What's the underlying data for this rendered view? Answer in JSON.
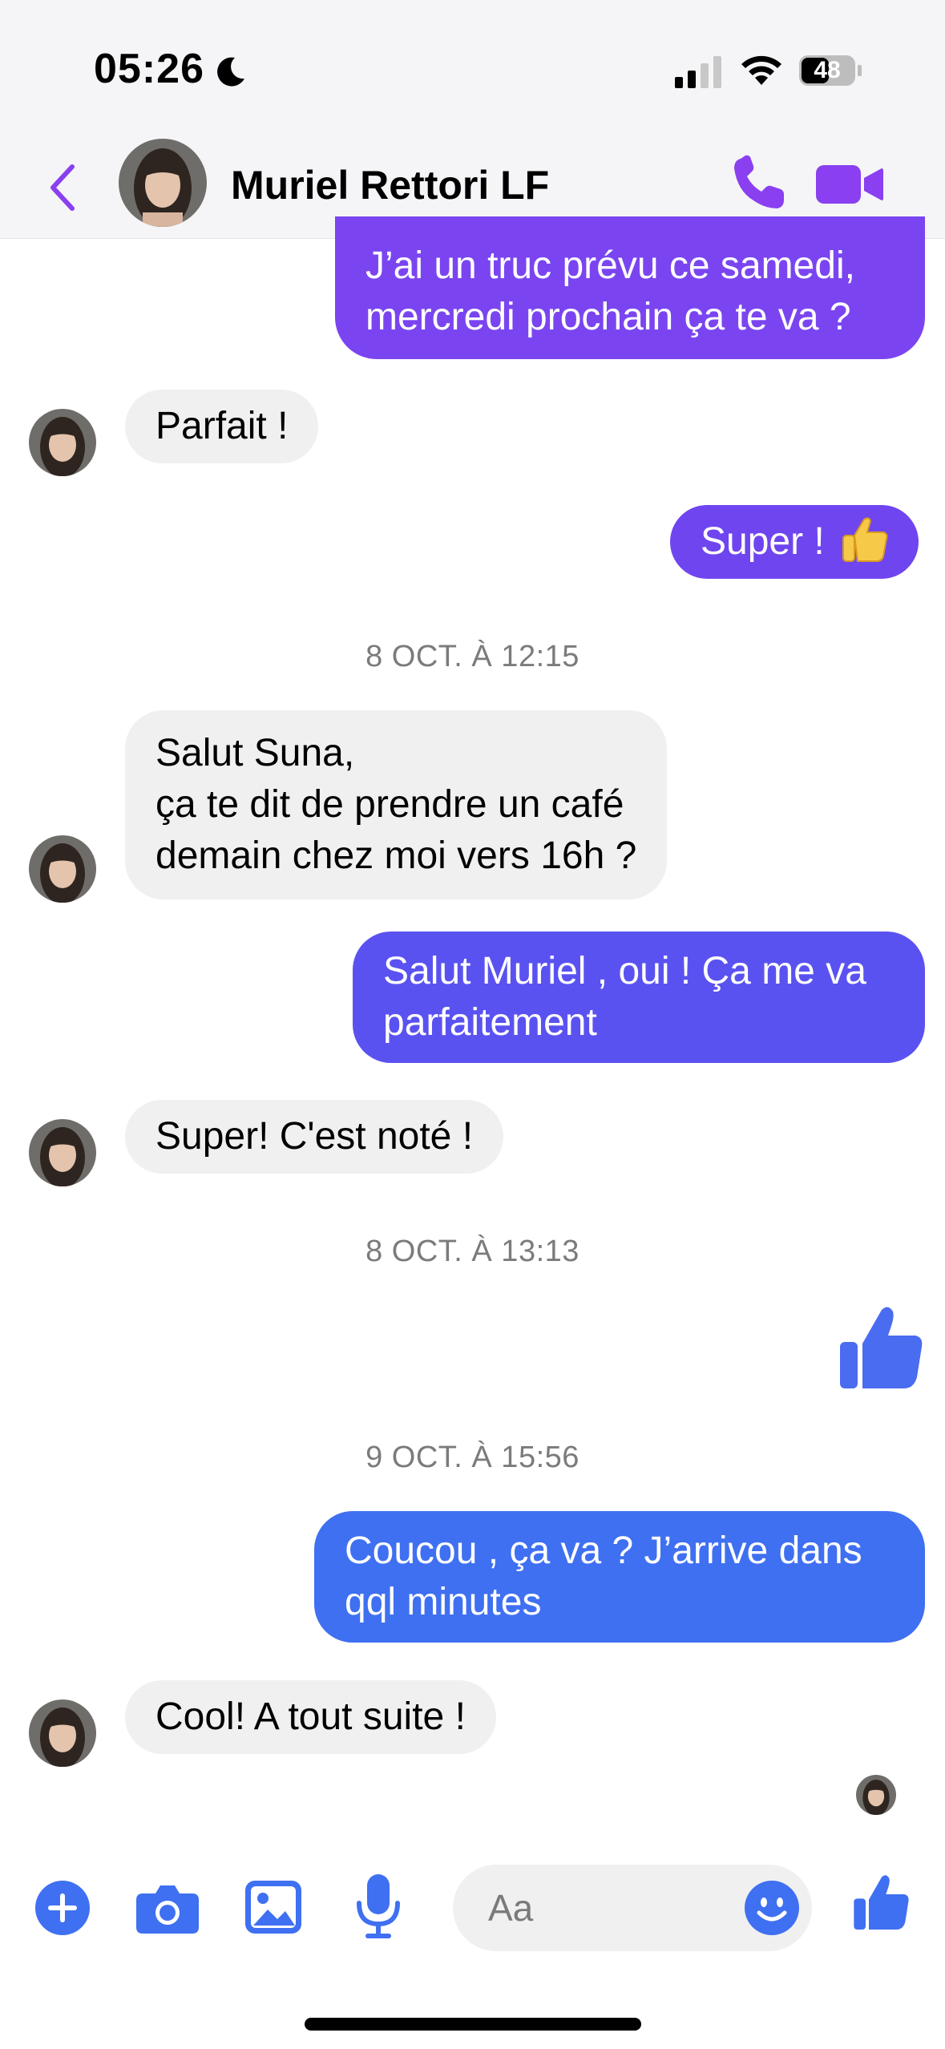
{
  "status_bar": {
    "time": "05:26",
    "battery": "48",
    "moon_icon": "moon-icon",
    "signal_icon": "cellular-signal-icon",
    "wifi_icon": "wifi-icon"
  },
  "header": {
    "name": "Muriel Rettori LF",
    "back_icon": "chevron-left-icon",
    "call_icon": "phone-icon",
    "video_icon": "video-camera-icon"
  },
  "colors": {
    "accent_purple": "#8a3ff0",
    "bubble_purple": "#7a45f0",
    "bubble_indigo": "#6a4ff0",
    "bubble_blue": "#4c63f0",
    "bubble_blue2": "#3f70f1",
    "like_blue": "#4a6cf0",
    "incoming_bg": "#f0f0f0",
    "timestamp": "#7b7b7e"
  },
  "messages": {
    "m1": "J’ai un truc prévu ce samedi,",
    "m1b": "mercredi prochain ça te va ?",
    "m2": "Parfait !",
    "m3": "Super !",
    "ts1": "8 OCT. À 12:15",
    "m4a": "Salut Suna,",
    "m4b": "ça te dit de prendre un café",
    "m4c": "demain chez moi vers 16h ?",
    "m5a": "Salut Muriel , oui ! Ça me va",
    "m5b": "parfaitement",
    "m6": "Super! C'est noté !",
    "ts2": "8 OCT. À 13:13",
    "ts3": "9 OCT. À 15:56",
    "m7a": "Coucou , ça va ? J’arrive dans",
    "m7b": "qql minutes",
    "m8": "Cool! A tout suite !"
  },
  "composer": {
    "placeholder": "Aa",
    "icons": [
      "plus-icon",
      "camera-icon",
      "image-icon",
      "microphone-icon",
      "smiley-icon",
      "thumbs-up-icon"
    ]
  }
}
